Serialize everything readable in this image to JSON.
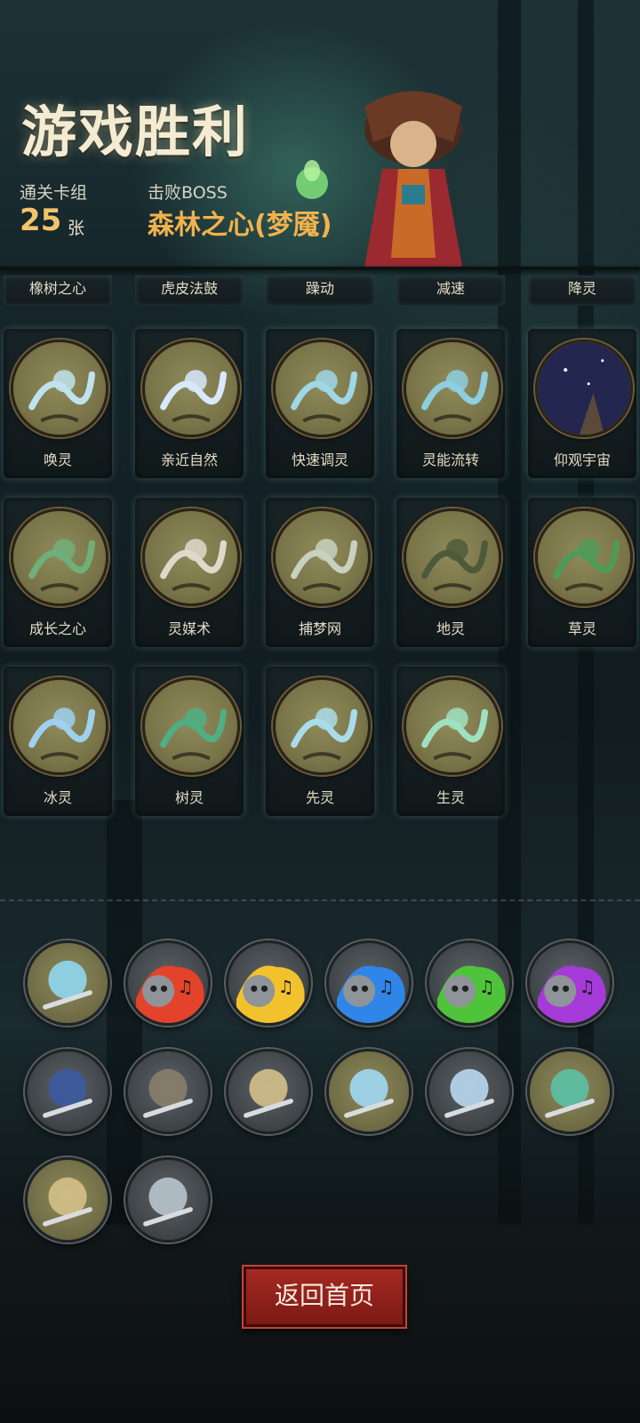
{
  "header": {
    "title": "游戏胜利",
    "cleared_label": "通关卡组",
    "cleared_count": "25",
    "cleared_unit": "张",
    "boss_label": "击败BOSS",
    "boss_name": "森林之心(梦魇)"
  },
  "cards_top_row": [
    "橡树之心",
    "虎皮法鼓",
    "躁动",
    "减速",
    "降灵"
  ],
  "cards": [
    {
      "name": "唤灵",
      "icon": "spirit-summon-icon"
    },
    {
      "name": "亲近自然",
      "icon": "wolf-nature-icon"
    },
    {
      "name": "快速调灵",
      "icon": "quick-spirit-icon"
    },
    {
      "name": "灵能流转",
      "icon": "spirit-flow-icon"
    },
    {
      "name": "仰观宇宙",
      "icon": "cosmos-icon"
    },
    {
      "name": "成长之心",
      "icon": "growth-heart-icon"
    },
    {
      "name": "灵媒术",
      "icon": "skull-medium-icon"
    },
    {
      "name": "捕梦网",
      "icon": "dreamcatcher-icon"
    },
    {
      "name": "地灵",
      "icon": "earth-spirit-icon"
    },
    {
      "name": "草灵",
      "icon": "grass-spirit-icon"
    },
    {
      "name": "冰灵",
      "icon": "ice-spirit-icon"
    },
    {
      "name": "树灵",
      "icon": "tree-spirit-icon"
    },
    {
      "name": "先灵",
      "icon": "ancestor-bird-icon"
    },
    {
      "name": "生灵",
      "icon": "life-butterfly-icon"
    }
  ],
  "relics": [
    {
      "icon": "chalice-relic-icon",
      "style": "gold"
    },
    {
      "icon": "red-music-skull-icon",
      "style": "grey",
      "color": "#e2432a"
    },
    {
      "icon": "yellow-music-skull-icon",
      "style": "grey",
      "color": "#f2c12e"
    },
    {
      "icon": "blue-music-skull-icon",
      "style": "grey",
      "color": "#2f86e8"
    },
    {
      "icon": "green-music-skull-icon",
      "style": "grey",
      "color": "#4fc43a"
    },
    {
      "icon": "purple-music-skull-icon",
      "style": "grey",
      "color": "#a63ad8"
    },
    {
      "icon": "spellbook-icon",
      "style": "grey"
    },
    {
      "icon": "storm-cloud-icon",
      "style": "grey"
    },
    {
      "icon": "coin-pouch-sword-icon",
      "style": "grey"
    },
    {
      "icon": "blue-lily-icon",
      "style": "gold"
    },
    {
      "icon": "ice-compass-icon",
      "style": "grey"
    },
    {
      "icon": "vine-orb-icon",
      "style": "gold"
    },
    {
      "icon": "coin-pouch-sword-icon",
      "style": "gold"
    },
    {
      "icon": "broken-blade-icon",
      "style": "grey"
    }
  ],
  "return_button_label": "返回首页",
  "colors": {
    "title": "#f4ecd2",
    "count": "#f2c46a",
    "boss": "#f2b24e",
    "button": "#a52a22"
  }
}
